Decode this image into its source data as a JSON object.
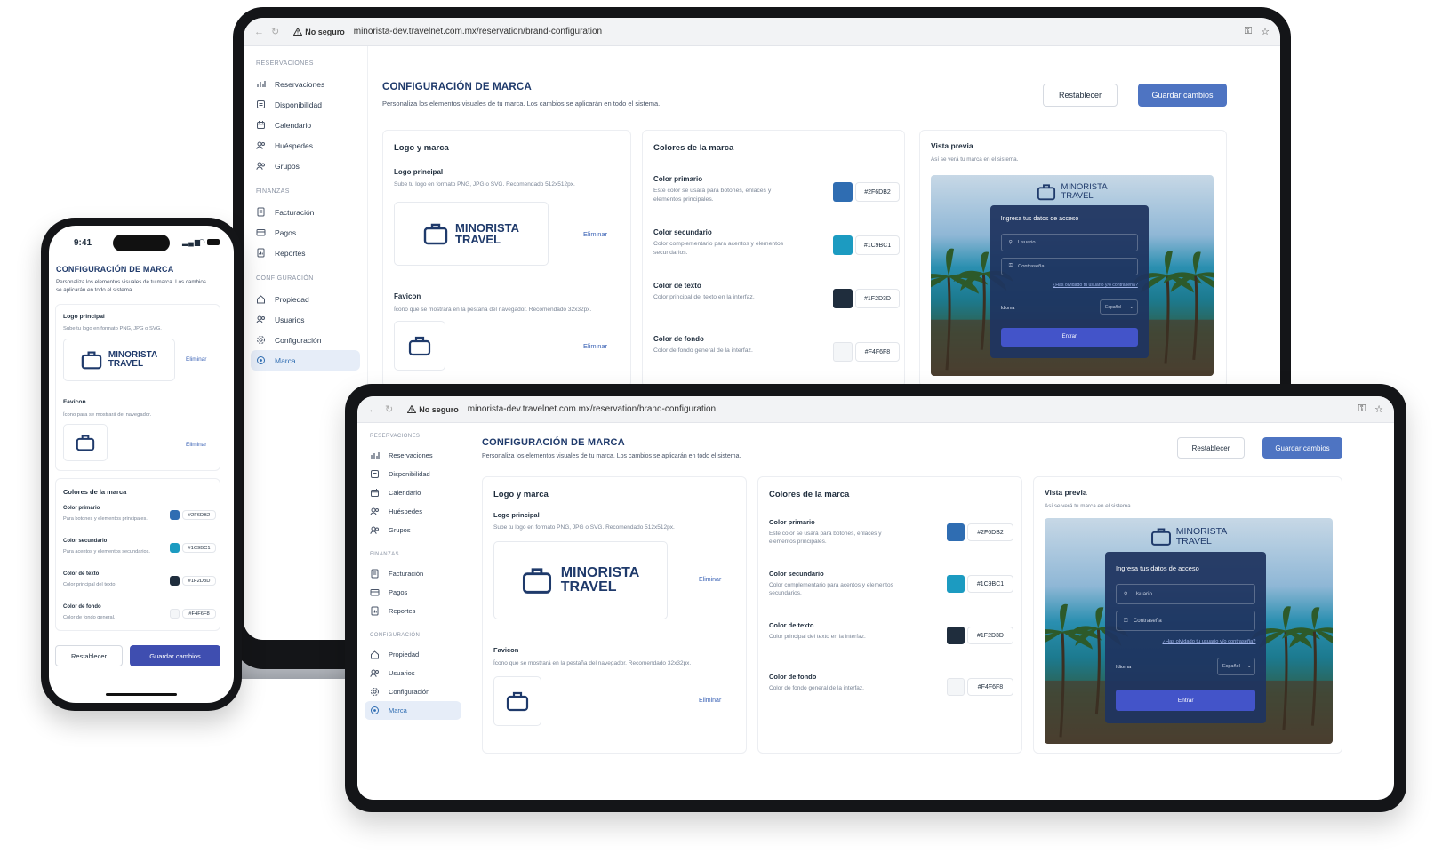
{
  "browser": {
    "security": "No seguro",
    "url": "minorista-dev.travelnet.com.mx/reservation/brand-configuration"
  },
  "sidebar": {
    "sections": [
      {
        "title": "RESERVACIONES",
        "items": [
          "Reservaciones",
          "Disponibilidad",
          "Calendario",
          "Huéspedes",
          "Grupos"
        ]
      },
      {
        "title": "FINANZAS",
        "items": [
          "Facturación",
          "Pagos",
          "Reportes"
        ]
      },
      {
        "title": "CONFIGURACIÓN",
        "items": [
          "Propiedad",
          "Usuarios",
          "Configuración",
          "Marca"
        ]
      }
    ]
  },
  "page": {
    "title": "CONFIGURACIÓN DE MARCA",
    "subtitle": "Personaliza los elementos visuales de tu marca. Los cambios se aplicarán en todo el sistema.",
    "reset": "Restablecer",
    "save": "Guardar cambios"
  },
  "logo_card": {
    "title": "Logo y marca",
    "main_label": "Logo principal",
    "main_hint": "Sube tu logo en formato PNG, JPG o SVG. Recomendado 512x512px.",
    "brand_line1": "MINORISTA",
    "brand_line2": "TRAVEL",
    "delete": "Eliminar",
    "favicon_label": "Favicon",
    "favicon_hint": "Ícono que se mostrará en la pestaña del navegador. Recomendado 32x32px."
  },
  "colors_card": {
    "title": "Colores de la marca",
    "colors": [
      {
        "name": "Color primario",
        "desc": "Este color se usará para botones, enlaces y elementos principales.",
        "hex": "#2F6DB2"
      },
      {
        "name": "Color secundario",
        "desc": "Color complementario para acentos y elementos secundarios.",
        "hex": "#1C9BC1"
      },
      {
        "name": "Color de texto",
        "desc": "Color principal del texto en la interfaz.",
        "hex": "#1F2D3D"
      },
      {
        "name": "Color de fondo",
        "desc": "Color de fondo general de la interfaz.",
        "hex": "#F4F6F8"
      }
    ]
  },
  "preview_card": {
    "title": "Vista previa",
    "hint": "Así se verá tu marca en el sistema.",
    "login_title": "Ingresa tus datos de acceso",
    "user_ph": "Usuario",
    "pass_ph": "Contraseña",
    "forgot": "¿Has olvidado tu usuario y/o contraseña?",
    "language_label": "Idioma",
    "language_value": "Español",
    "enter": "Entrar"
  },
  "phone": {
    "time": "9:41",
    "title": "CONFIGURACIÓN DE MARCA",
    "subtitle": "Personaliza los elementos visuales de tu marca. Los cambios se aplicarán en todo el sistema.",
    "main_label": "Logo principal",
    "main_hint": "Sube tu logo en formato PNG, JPG o SVG.",
    "favicon_label": "Favicon",
    "favicon_hint": "Ícono para se mostrará del navegador.",
    "colors_title": "Colores de la marca",
    "colors": [
      {
        "name": "Color primario",
        "desc": "Para botones y elementos principales.",
        "hex": "#2F6DB2"
      },
      {
        "name": "Color secundario",
        "desc": "Para acentos y elementos secundarios.",
        "hex": "#1C9BC1"
      },
      {
        "name": "Color de texto",
        "desc": "Color principal del texto.",
        "hex": "#1F2D3D"
      },
      {
        "name": "Color de fondo",
        "desc": "Color de fondo general.",
        "hex": "#F4F6F8"
      }
    ],
    "reset": "Restablecer",
    "save": "Guardar cambios"
  }
}
